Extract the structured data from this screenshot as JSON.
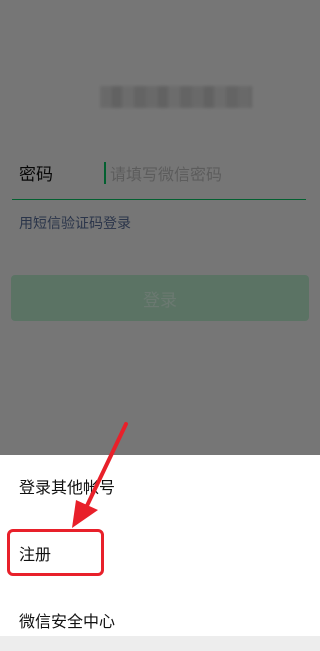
{
  "login": {
    "password_label": "密码",
    "password_placeholder": "请填写微信密码",
    "sms_login_link": "用短信验证码登录",
    "login_button": "登录"
  },
  "sheet": {
    "items": [
      {
        "label": "登录其他帐号"
      },
      {
        "label": "注册"
      },
      {
        "label": "微信安全中心"
      }
    ]
  },
  "annotation": {
    "highlight_color": "#e8202a",
    "highlighted_item": "注册"
  },
  "colors": {
    "accent": "#07c160",
    "link": "#576b95"
  }
}
